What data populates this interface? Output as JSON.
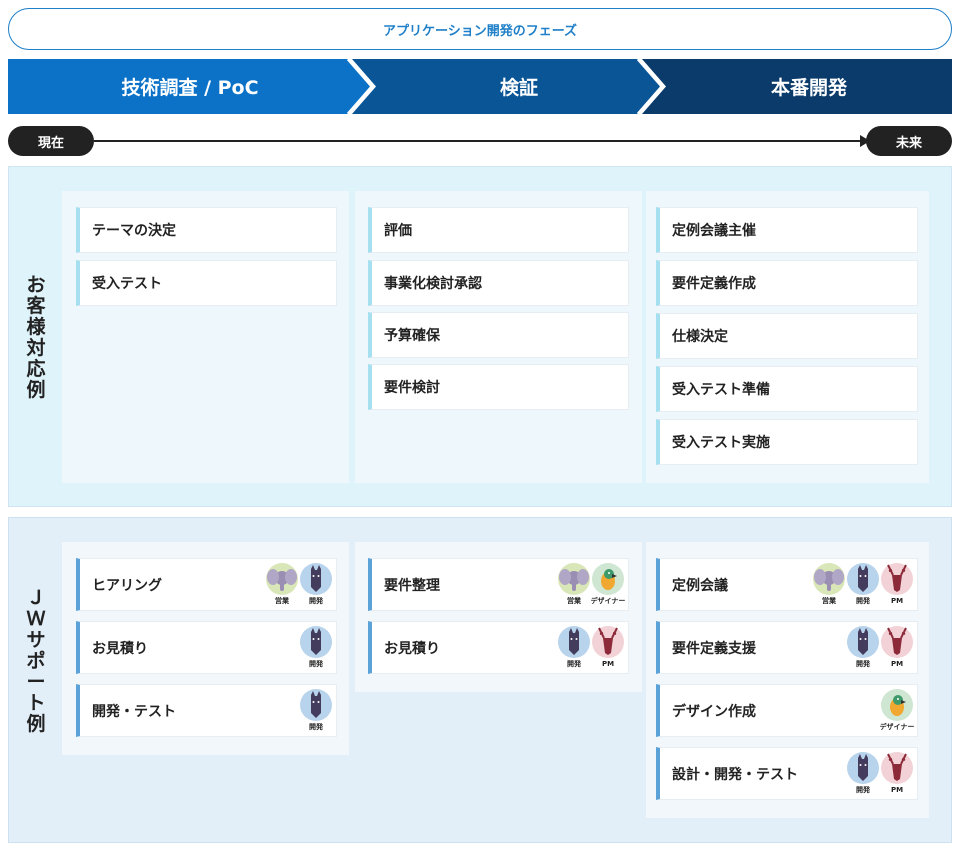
{
  "header": {
    "title": "アプリケーション開発のフェーズ"
  },
  "phases": [
    {
      "label": "技術調査 / PoC",
      "color": "#0b72c8"
    },
    {
      "label": "検証",
      "color": "#0a5596"
    },
    {
      "label": "本番開発",
      "color": "#0a3b6a"
    }
  ],
  "timeline": {
    "start": "現在",
    "end": "未来"
  },
  "customer": {
    "title": [
      "お",
      "客",
      "様",
      "対",
      "応",
      "例"
    ],
    "columns": [
      [
        "テーマの決定",
        "受入テスト"
      ],
      [
        "評価",
        "事業化検討承認",
        "予算確保",
        "要件検討"
      ],
      [
        "定例会議主催",
        "要件定義作成",
        "仕様決定",
        "受入テスト準備",
        "受入テスト実施"
      ]
    ]
  },
  "support": {
    "title": [
      "Ｊ",
      "Ｗ",
      "サ",
      "ポ",
      "ー",
      "ト",
      "例"
    ],
    "roles": {
      "sales": {
        "label": "営業",
        "icon": "elephant-icon",
        "bg": "#d9e6b8"
      },
      "dev": {
        "label": "開発",
        "icon": "horse-icon",
        "bg": "#b8d3ec"
      },
      "designer": {
        "label": "デザイナー",
        "icon": "parrot-icon",
        "bg": "#cfe6d2"
      },
      "pm": {
        "label": "PM",
        "icon": "antelope-icon",
        "bg": "#f2d2d6"
      }
    },
    "columns": [
      [
        {
          "label": "ヒアリング",
          "roles": [
            "sales",
            "dev"
          ]
        },
        {
          "label": "お見積り",
          "roles": [
            "dev"
          ]
        },
        {
          "label": "開発・テスト",
          "roles": [
            "dev"
          ]
        }
      ],
      [
        {
          "label": "要件整理",
          "roles": [
            "sales",
            "designer"
          ]
        },
        {
          "label": "お見積り",
          "roles": [
            "dev",
            "pm"
          ]
        }
      ],
      [
        {
          "label": "定例会議",
          "roles": [
            "sales",
            "dev",
            "pm"
          ]
        },
        {
          "label": "要件定義支援",
          "roles": [
            "dev",
            "pm"
          ]
        },
        {
          "label": "デザイン作成",
          "roles": [
            "designer"
          ]
        },
        {
          "label": "設計・開発・テスト",
          "roles": [
            "dev",
            "pm"
          ]
        }
      ]
    ]
  }
}
